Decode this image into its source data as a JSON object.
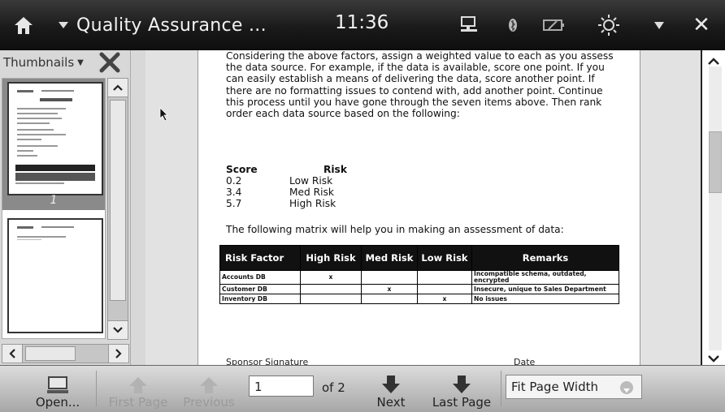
{
  "topbar": {
    "title": "Quality Assurance ...",
    "clock": "11:36",
    "icons": [
      "home-icon",
      "network-icon",
      "bluetooth-icon",
      "battery-icon",
      "brightness-icon",
      "dropdown-icon",
      "close-icon"
    ]
  },
  "sidebar": {
    "header_label": "Thumbnails",
    "thumbnails": [
      {
        "page": "1",
        "selected": true
      },
      {
        "page": "2",
        "selected": false
      }
    ]
  },
  "document": {
    "paragraph": "Considering the above factors, assign a weighted value to each as you assess the data source.  For example, if the data is available, score one point.  If you can easily establish a means of delivering the data, score another point.  If there are no formatting issues to contend with, add another point.  Continue this process until you have gone through the seven items above.  Then rank order each data source based on the following:",
    "score_header": "Score",
    "risk_header": "Risk",
    "scores": [
      {
        "score": "0.2",
        "risk": "Low Risk"
      },
      {
        "score": "3.4",
        "risk": "Med Risk"
      },
      {
        "score": "5.7",
        "risk": "High Risk"
      }
    ],
    "matrix_intro": "The following matrix will help you in making an assessment of data:",
    "matrix": {
      "headers": [
        "Risk Factor",
        "High Risk",
        "Med Risk",
        "Low Risk",
        "Remarks"
      ],
      "rows": [
        [
          "Accounts DB",
          "x",
          "",
          "",
          "Incompatible schema, outdated, encrypted"
        ],
        [
          "Customer DB",
          "",
          "x",
          "",
          "Insecure, unique to Sales Department"
        ],
        [
          "Inventory DB",
          "",
          "",
          "x",
          "No issues"
        ]
      ]
    },
    "signature_label": "Sponsor Signature",
    "date_label": "Date"
  },
  "bottombar": {
    "open_label": "Open...",
    "first_label": "First Page",
    "previous_label": "Previous",
    "page_value": "1",
    "of_label": "of 2",
    "next_label": "Next",
    "last_label": "Last Page",
    "zoom_value": "Fit Page Width"
  }
}
